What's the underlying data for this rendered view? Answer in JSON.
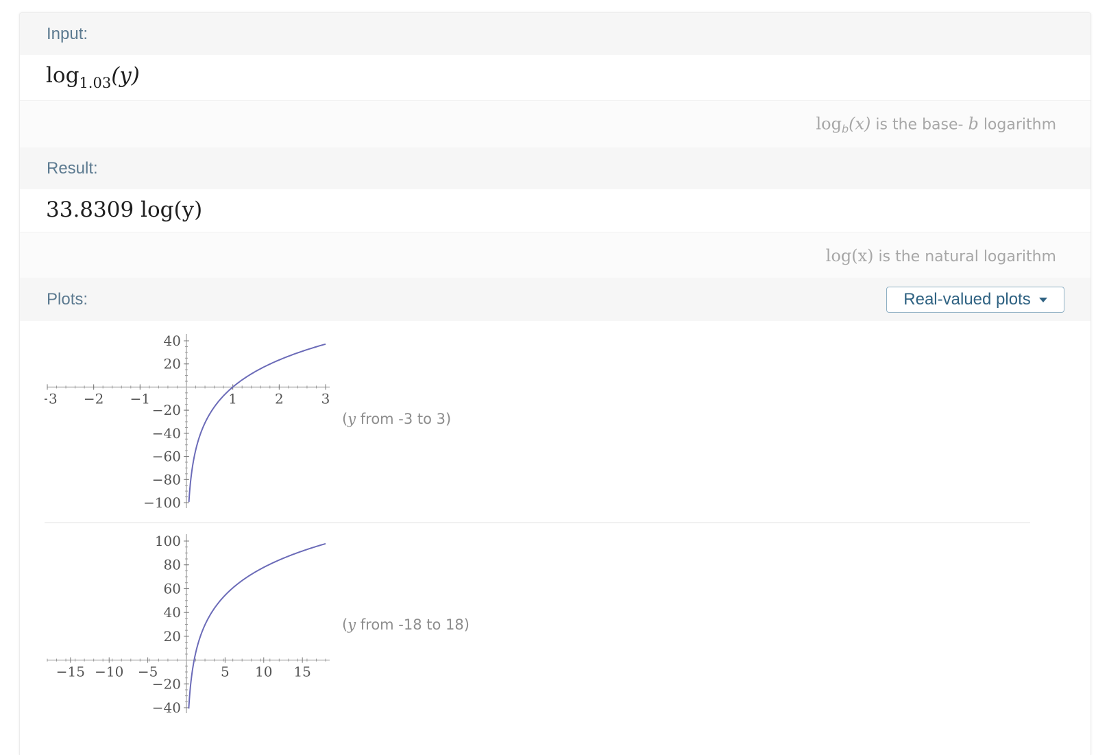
{
  "input": {
    "title": "Input:",
    "expr_log": "log",
    "expr_base": "1.03",
    "expr_arg": "(y)",
    "note_log": "log",
    "note_base": "b",
    "note_arg": "(x)",
    "note_text": " is the base- ",
    "note_var": "b",
    "note_tail": " logarithm"
  },
  "result": {
    "title": "Result:",
    "expr": "33.8309 log(y)",
    "note_math": "log(x)",
    "note_text": " is the natural logarithm"
  },
  "plots": {
    "title": "Plots:",
    "dropdown_label": "Real-valued plots",
    "items": [
      {
        "caption_open": "(",
        "caption_var": "y",
        "caption_text": " from -3 to 3)"
      },
      {
        "caption_open": "(",
        "caption_var": "y",
        "caption_text": " from -18 to 18)"
      }
    ]
  },
  "colors": {
    "curve": "#6b6bb8",
    "label": "#5c7a90",
    "accent": "#2f6282"
  },
  "chart_data": [
    {
      "type": "line",
      "function": "33.8309 log(y)",
      "xlim": [
        -3,
        3
      ],
      "ylim": [
        -100,
        40
      ],
      "x_ticks": [
        -3,
        -2,
        -1,
        1,
        2,
        3
      ],
      "y_ticks": [
        40,
        20,
        -20,
        -40,
        -60,
        -80,
        -100
      ],
      "x_domain": [
        0.053,
        3
      ]
    },
    {
      "type": "line",
      "function": "33.8309 log(y)",
      "xlim": [
        -18,
        18
      ],
      "ylim": [
        -40,
        100
      ],
      "x_ticks": [
        -15,
        -10,
        -5,
        5,
        10,
        15
      ],
      "y_ticks": [
        100,
        80,
        60,
        40,
        20,
        -20,
        -40
      ],
      "x_domain": [
        0.3,
        18
      ]
    }
  ]
}
